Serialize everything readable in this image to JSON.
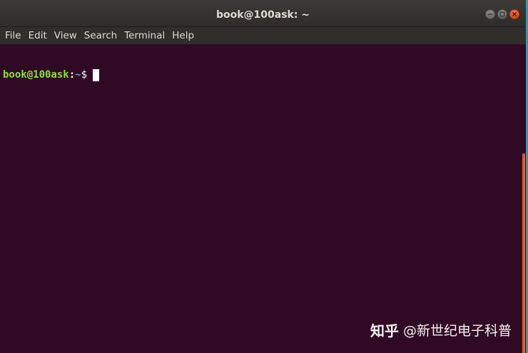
{
  "window": {
    "title": "book@100ask: ~",
    "controls": {
      "minimize_icon": "minimize-icon",
      "maximize_icon": "maximize-icon",
      "close_icon": "close-icon"
    }
  },
  "menubar": {
    "items": [
      "File",
      "Edit",
      "View",
      "Search",
      "Terminal",
      "Help"
    ]
  },
  "terminal": {
    "prompt_user": "book@100ask",
    "prompt_colon": ":",
    "prompt_path": "~",
    "prompt_symbol": "$",
    "colors": {
      "background": "#300a24",
      "user": "#8ae234",
      "path": "#729fcf",
      "scrollbar": "#e05e2c"
    }
  },
  "watermark": {
    "logo": "知乎",
    "handle": "@新世纪电子科普"
  }
}
